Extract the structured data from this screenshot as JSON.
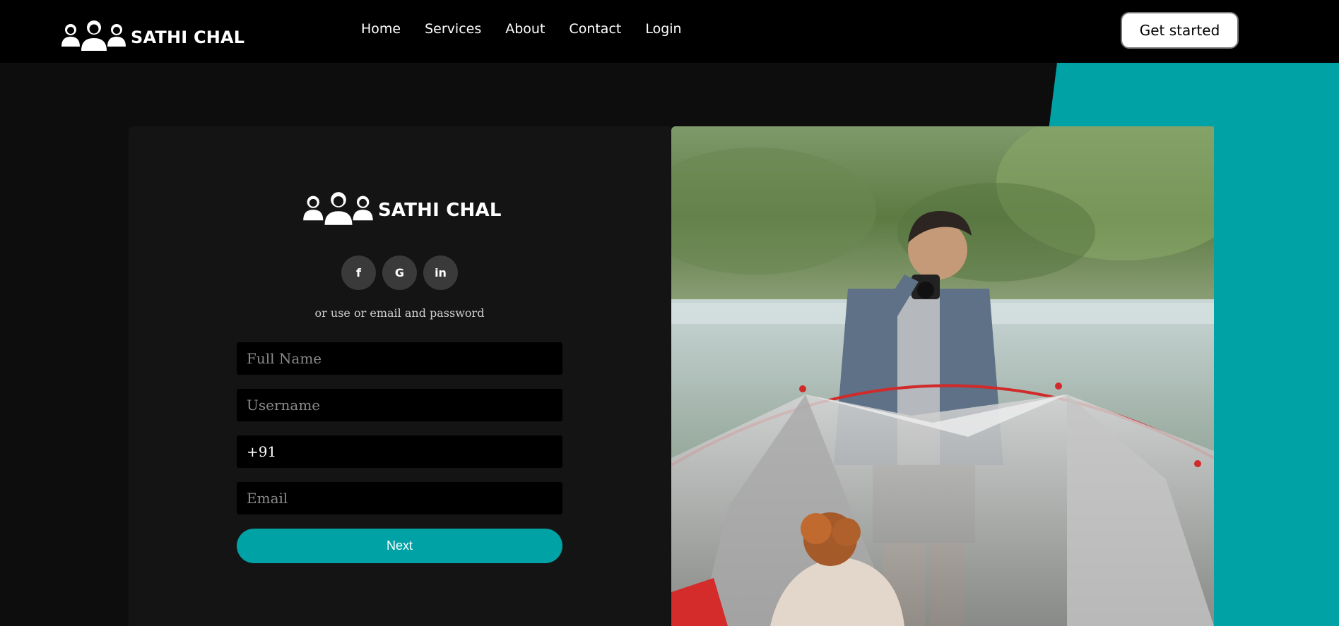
{
  "brand": {
    "name": "SATHI CHAL"
  },
  "nav": {
    "links": [
      "Home",
      "Services",
      "About",
      "Contact",
      "Login"
    ],
    "cta": "Get started"
  },
  "form": {
    "brand_name": "SATHI CHAL",
    "socials": [
      {
        "icon": "facebook-icon",
        "glyph": "f"
      },
      {
        "icon": "google-icon",
        "glyph": "G"
      },
      {
        "icon": "linkedin-icon",
        "glyph": "in"
      }
    ],
    "alt_text": "or use or email and password",
    "full_name_placeholder": "Full Name",
    "username_placeholder": "Username",
    "phone_value": "+91",
    "email_placeholder": "Email",
    "next_label": "Next"
  },
  "colors": {
    "accent": "#00a2a6",
    "navbar": "#000000",
    "card": "#141414"
  }
}
